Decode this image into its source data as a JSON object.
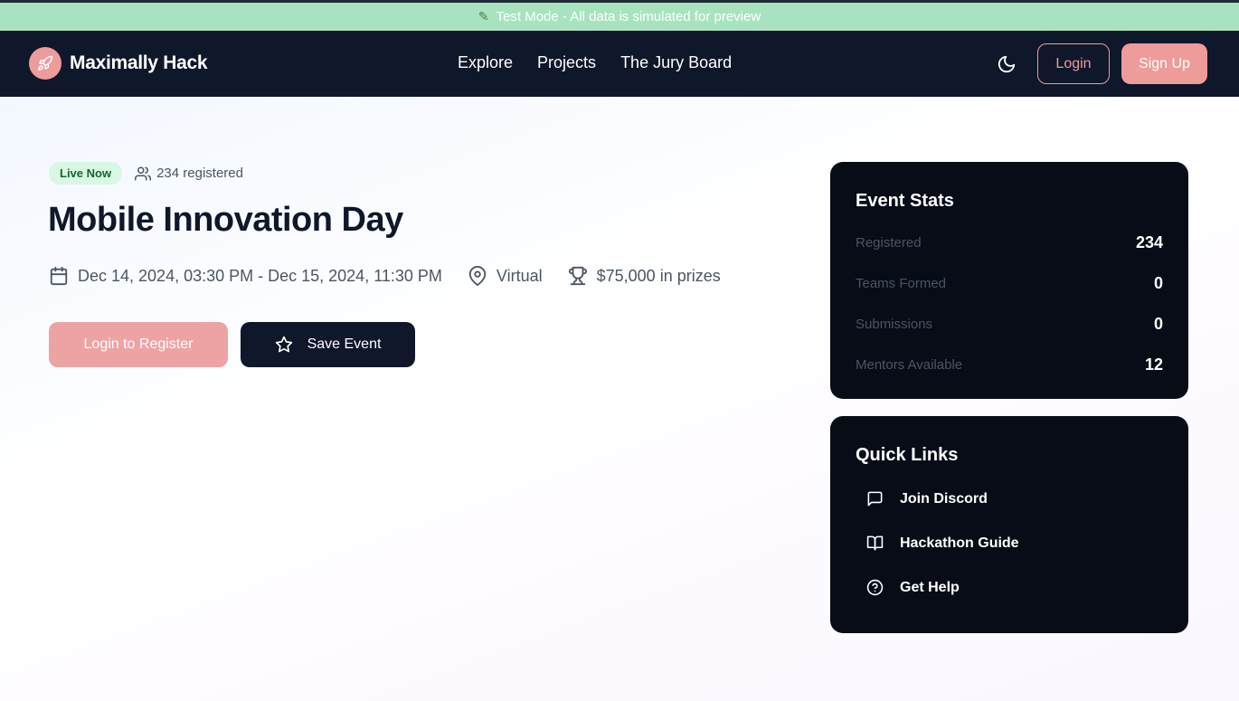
{
  "banner": {
    "text": "Test Mode - All data is simulated for preview",
    "icon": "pencil-icon"
  },
  "nav": {
    "brand": "Maximally Hack",
    "links": [
      "Explore",
      "Projects",
      "The Jury Board"
    ],
    "login": "Login",
    "signup": "Sign Up"
  },
  "event": {
    "status": "Live Now",
    "registered": "234 registered",
    "title": "Mobile Innovation Day",
    "date_range": "Dec 14, 2024, 03:30 PM - Dec 15, 2024, 11:30 PM",
    "location": "Virtual",
    "prizes": "$75,000 in prizes",
    "register_button": "Login to Register",
    "save_button": "Save Event"
  },
  "stats": {
    "title": "Event Stats",
    "rows": [
      {
        "label": "Registered",
        "value": "234"
      },
      {
        "label": "Teams Formed",
        "value": "0"
      },
      {
        "label": "Submissions",
        "value": "0"
      },
      {
        "label": "Mentors Available",
        "value": "12"
      }
    ]
  },
  "quick_links": {
    "title": "Quick Links",
    "items": [
      {
        "label": "Join Discord",
        "icon": "message-square-icon"
      },
      {
        "label": "Hackathon Guide",
        "icon": "book-open-icon"
      },
      {
        "label": "Get Help",
        "icon": "help-circle-icon"
      }
    ]
  },
  "colors": {
    "accent": "#ee9b9b",
    "navbar": "#0f172a",
    "card": "#080c17",
    "banner": "#a7e3bf",
    "live_badge_bg": "#d8f8e1",
    "live_badge_text": "#166534"
  }
}
